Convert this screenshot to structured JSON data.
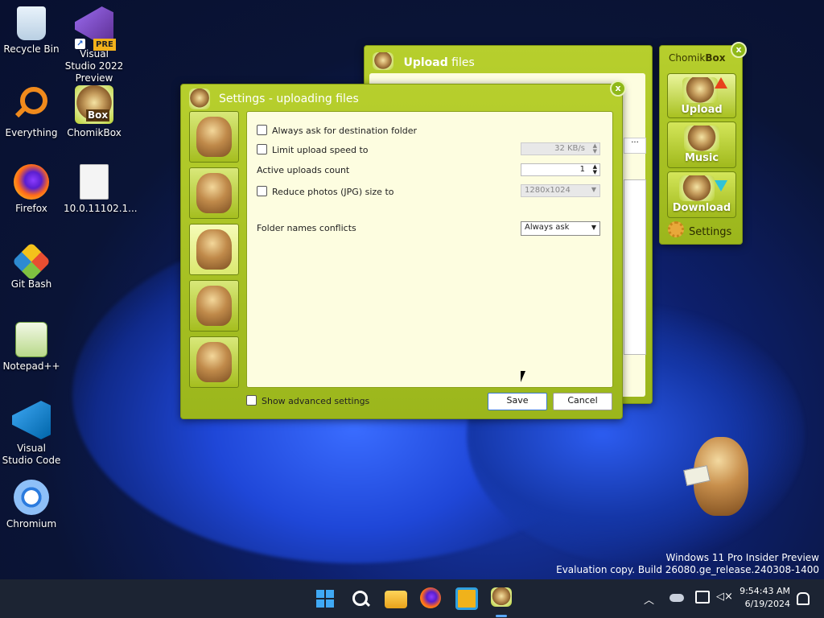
{
  "desktop": {
    "icons": [
      {
        "label": "Recycle Bin",
        "icon": "recycle-bin-icon"
      },
      {
        "label": "Visual Studio 2022 Preview",
        "icon": "visual-studio-icon",
        "badge": "PRE"
      },
      {
        "label": "Everything",
        "icon": "search-magnifier-icon"
      },
      {
        "label": "ChomikBox",
        "icon": "chomikbox-icon",
        "badge": "Box"
      },
      {
        "label": "Firefox",
        "icon": "firefox-icon"
      },
      {
        "label": "10.0.11102.1...",
        "icon": "file-icon"
      },
      {
        "label": "Git Bash",
        "icon": "git-icon"
      },
      {
        "label": "Notepad++",
        "icon": "notepadpp-icon"
      },
      {
        "label": "Visual Studio Code",
        "icon": "vscode-icon"
      },
      {
        "label": "Chromium",
        "icon": "chromium-icon"
      }
    ],
    "watermark_line1": "Windows 11 Pro Insider Preview",
    "watermark_line2": "Evaluation copy. Build 26080.ge_release.240308-1400"
  },
  "upload_window": {
    "title_bold": "Upload",
    "title_rest": " files"
  },
  "chomikbox_panel": {
    "title_a": "Chomik",
    "title_b": "Box",
    "buttons": [
      "Upload",
      "Music",
      "Download"
    ],
    "settings_label": "Settings"
  },
  "settings_dialog": {
    "title": "Settings - uploading files",
    "options": {
      "always_ask": {
        "label": "Always ask for destination folder",
        "checked": false
      },
      "limit_speed": {
        "label": "Limit upload speed to",
        "checked": false,
        "value": "32 KB/s"
      },
      "active_uploads": {
        "label": "Active uploads count",
        "value": "1"
      },
      "reduce_photos": {
        "label": "Reduce photos (JPG) size to",
        "checked": false,
        "value": "1280x1024"
      },
      "folder_conflicts": {
        "label": "Folder names conflicts",
        "value": "Always ask"
      }
    },
    "show_advanced": "Show advanced settings",
    "save": "Save",
    "cancel": "Cancel"
  },
  "taskbar": {
    "time": "9:54:43 AM",
    "date": "6/19/2024"
  },
  "colors": {
    "accent_green": "#b7cf2d",
    "panel_bg": "#fdfde0",
    "taskbar": "#1c2433"
  }
}
